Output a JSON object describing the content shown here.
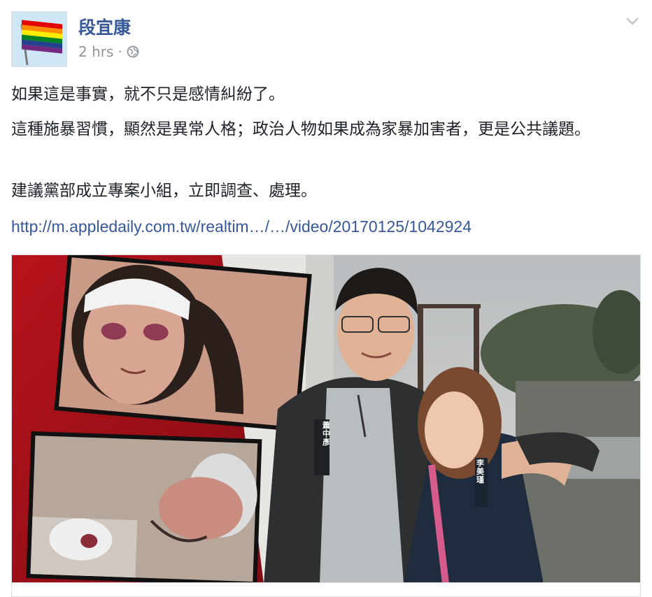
{
  "post": {
    "author_name": "段宜康",
    "timestamp": "2 hrs",
    "separator": "·",
    "paragraphs": [
      "如果這是事實，就不只是感情糾紛了。",
      "這種施暴習慣，顯然是異常人格；政治人物如果成為家暴加害者，更是公共議題。",
      "建議黨部成立專案小組，立即調查、處理。"
    ],
    "link_text": "http://m.appledaily.com.tw/realtim…/…/video/20170125/1042924"
  },
  "photo": {
    "left_name_tag": "蕭中彥",
    "right_name_tag": "李美瑾"
  },
  "colors": {
    "brand": "#365899",
    "text": "#1d2129",
    "meta": "#90949c",
    "photo_red": "#a8141c"
  },
  "icons": {
    "privacy": "globe-icon",
    "menu": "chevron-down-icon"
  }
}
